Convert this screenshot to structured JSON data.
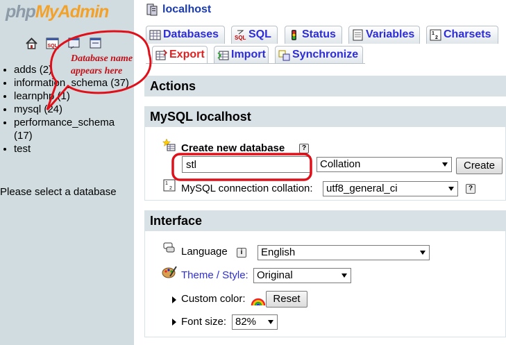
{
  "logo": {
    "part1": "php",
    "part2": "MyAdmin"
  },
  "nav_icons": [
    "home-icon",
    "sql-icon",
    "query-window-icon",
    "docs-icon"
  ],
  "databases": [
    "adds (2)",
    "information_schema (37)",
    "learnphp (1)",
    "mysql (24)",
    "performance_schema (17)",
    "test"
  ],
  "select_message": "Please select a database",
  "server": {
    "title": "localhost"
  },
  "tabs": [
    {
      "label": "Databases",
      "icon": "databases-icon"
    },
    {
      "label": "SQL",
      "icon": "sql-icon"
    },
    {
      "label": "Status",
      "icon": "status-icon"
    },
    {
      "label": "Variables",
      "icon": "variables-icon"
    },
    {
      "label": "Charsets",
      "icon": "charsets-icon"
    },
    {
      "label": "Export",
      "icon": "export-icon",
      "active": true
    },
    {
      "label": "Import",
      "icon": "import-icon"
    },
    {
      "label": "Synchronize",
      "icon": "synchronize-icon"
    }
  ],
  "actions": {
    "title": "Actions"
  },
  "mysql": {
    "title": "MySQL localhost",
    "create_db_label": "Create new database",
    "db_name_value": "stl",
    "collation_selected": "Collation",
    "create_button": "Create",
    "connection_collation_label": "MySQL connection collation:",
    "connection_collation_value": "utf8_general_ci"
  },
  "interface": {
    "title": "Interface",
    "language_label": "Language",
    "language_value": "English",
    "theme_label": "Theme / Style:",
    "theme_value": "Original",
    "custom_color_label": "Custom color:",
    "reset_button": "Reset",
    "font_size_label": "Font size:",
    "font_size_value": "82%"
  },
  "annotation": {
    "line1": "Database name",
    "line2": "appears here"
  },
  "colors": {
    "annotation_red": "#e0101a",
    "link_blue": "#2c2cd8",
    "active_tab": "#e02020"
  }
}
